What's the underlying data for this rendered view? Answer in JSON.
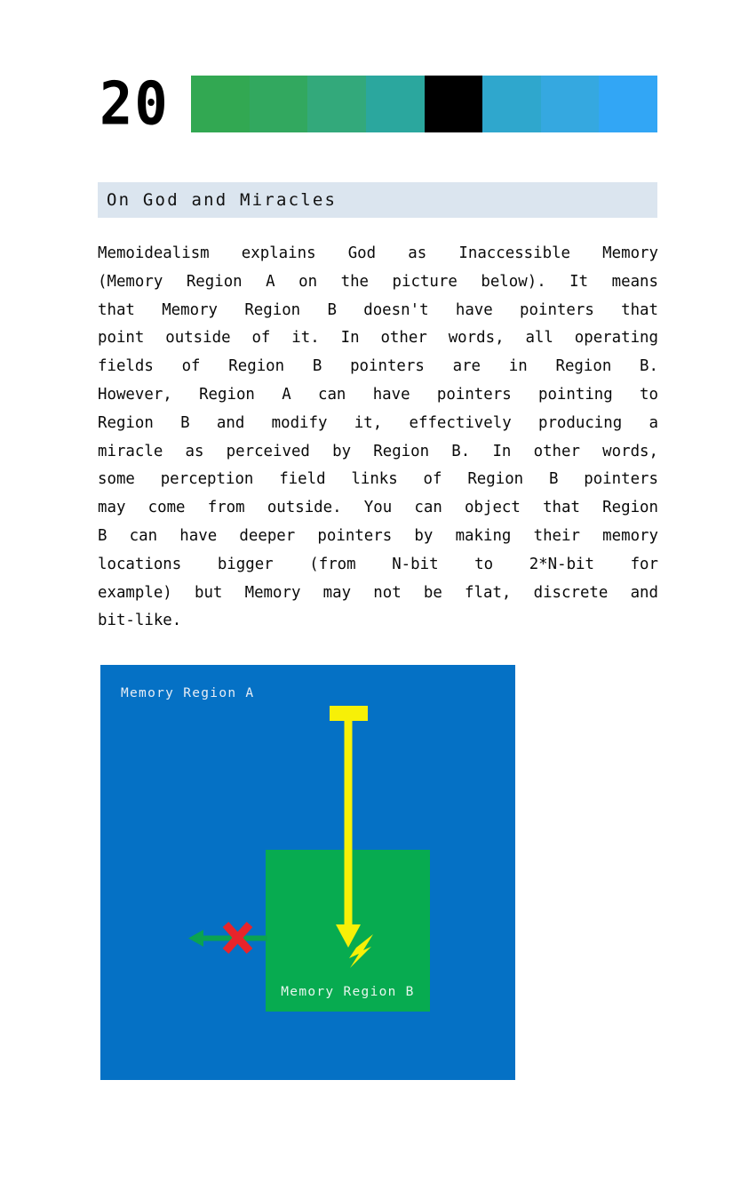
{
  "header": {
    "chapter_number": "20",
    "color_bands": [
      "#32a852",
      "#32a85f",
      "#33a97b",
      "#2ba79e",
      "#000000",
      "#2fa7cd",
      "#35a8e0",
      "#32a6f5"
    ]
  },
  "section": {
    "title": "On God and Miracles"
  },
  "body": {
    "lines": [
      "Memoidealism explains God as Inaccessible Memory",
      "(Memory Region A on the picture below). It means",
      "that Memory Region B doesn't have pointers that",
      "point outside of it. In other words, all operating",
      "fields of Region B pointers are in Region B.",
      "However, Region A can have pointers pointing to",
      "Region B and modify it, effectively producing a",
      "miracle as perceived by Region B. In other words,",
      "some perception field links of Region B pointers",
      "may come from outside. You can object that Region",
      "B can have deeper pointers by making their memory",
      "locations bigger (from N-bit to 2*N-bit for",
      "example) but Memory may not be flat, discrete and",
      "bit-like."
    ]
  },
  "diagram": {
    "region_a_label": "Memory Region A",
    "region_b_label": "Memory Region B",
    "colors": {
      "region_a_fill": "#0571c5",
      "region_b_fill": "#07ab50",
      "pointer_arrow": "#f7f007",
      "blocked_arrow": "#0ba350",
      "cross_mark": "#e8242b",
      "lightning": "#f7f007"
    }
  }
}
